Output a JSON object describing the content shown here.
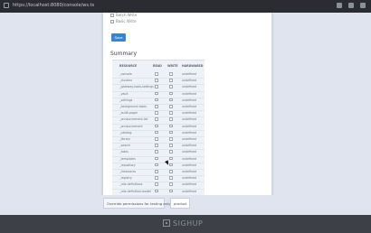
{
  "browser": {
    "url": "https://localhost:8080/console/ws.ts"
  },
  "form": {
    "checkboxes": [
      {
        "label": "Batch Write"
      },
      {
        "label": "Basic Write"
      }
    ],
    "save_label": "Save"
  },
  "summary": {
    "title": "Summary",
    "columns": [
      "RESOURCE",
      "READ",
      "WRITE",
      "HARDWARED"
    ],
    "rows": [
      {
        "resource": "_console",
        "hardwared": "undefined"
      },
      {
        "resource": "_clusters",
        "hardwared": "undefined"
      },
      {
        "resource": "_gateway-tools-settings",
        "hardwared": "undefined"
      },
      {
        "resource": "_vault",
        "hardwared": "undefined"
      },
      {
        "resource": "_settings",
        "hardwared": "undefined"
      },
      {
        "resource": "_background-tasks",
        "hardwared": "undefined"
      },
      {
        "resource": "_audit-pager",
        "hardwared": "undefined"
      },
      {
        "resource": "_announcement-list",
        "hardwared": "undefined"
      },
      {
        "resource": "_announcement",
        "hardwared": "undefined"
      },
      {
        "resource": "_catalog",
        "hardwared": "undefined"
      },
      {
        "resource": "_library",
        "hardwared": "undefined"
      },
      {
        "resource": "_search",
        "hardwared": "undefined"
      },
      {
        "resource": "_tasks",
        "hardwared": "undefined"
      },
      {
        "resource": "_templates",
        "hardwared": "undefined"
      },
      {
        "resource": "_repository",
        "hardwared": "undefined"
      },
      {
        "resource": "_timezones",
        "hardwared": "undefined"
      },
      {
        "resource": "_registry",
        "hardwared": "undefined"
      },
      {
        "resource": "_role-definitions",
        "hardwared": "undefined"
      },
      {
        "resource": "_role-definition-model",
        "hardwared": "undefined"
      }
    ]
  },
  "dev": {
    "label": "Override permissions for testing only",
    "select_value": "product"
  },
  "footer": {
    "logo_text": "SIGHUP"
  }
}
